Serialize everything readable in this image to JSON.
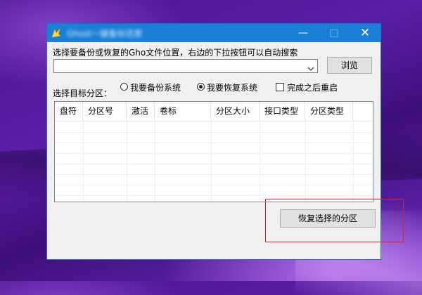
{
  "window": {
    "title": "Ghost一键备份还原",
    "controls": {
      "minimize": "—",
      "maximize": "□",
      "close": "✕"
    }
  },
  "gho": {
    "prompt": "选择要备份或恢复的Gho文件位置，右边的下拉按钮可以自动搜索",
    "path_value": "",
    "browse_label": "浏览"
  },
  "target": {
    "label": "选择目标分区：",
    "options": [
      {
        "label": "我要备份系统",
        "selected": false
      },
      {
        "label": "我要恢复系统",
        "selected": true
      }
    ],
    "restart_label": "完成之后重启",
    "restart_checked": false
  },
  "partition_table": {
    "columns": [
      "盘符",
      "分区号",
      "激活",
      "卷标",
      "分区大小",
      "接口类型",
      "分区类型"
    ],
    "rows": []
  },
  "actions": {
    "restore_label": "恢复选择的分区"
  },
  "colors": {
    "titlebar": "#1a7fd6",
    "highlight": "#e0202a"
  }
}
